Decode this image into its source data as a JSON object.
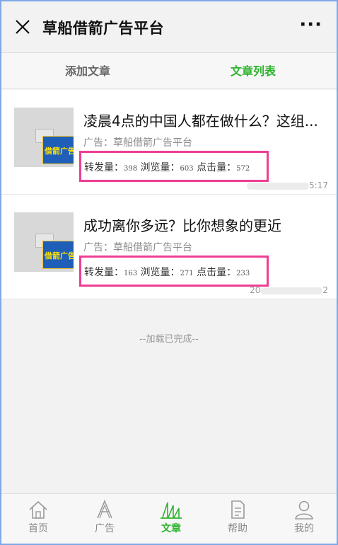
{
  "header": {
    "title": "草船借箭广告平台",
    "more": "···"
  },
  "tabs": [
    {
      "label": "添加文章",
      "active": false
    },
    {
      "label": "文章列表",
      "active": true
    }
  ],
  "articles": [
    {
      "title": "凌晨4点的中国人都在做什么？这组...",
      "source": "广告：草船借箭广告平台",
      "stats": {
        "forward_label": "转发量：",
        "forward": "398",
        "views_label": "浏览量：",
        "views": "603",
        "clicks_label": "点击量：",
        "clicks": "572"
      },
      "thumb_text": "借箭广告",
      "time_tail": "5:17"
    },
    {
      "title": "成功离你多远？比你想象的更近",
      "source": "广告：草船借箭广告平台",
      "stats": {
        "forward_label": "转发量：",
        "forward": "163",
        "views_label": "浏览量：",
        "views": "271",
        "clicks_label": "点击量：",
        "clicks": "233"
      },
      "thumb_text": "借箭广告",
      "time_head": "20",
      "time_tail": "2"
    }
  ],
  "loaded_text": "--加载已完成--",
  "nav": [
    {
      "label": "首页",
      "icon": "home-icon",
      "active": false
    },
    {
      "label": "广告",
      "icon": "ad-icon",
      "active": false
    },
    {
      "label": "文章",
      "icon": "article-icon",
      "active": true
    },
    {
      "label": "帮助",
      "icon": "help-icon",
      "active": false
    },
    {
      "label": "我的",
      "icon": "user-icon",
      "active": false
    }
  ],
  "colors": {
    "accent": "#2db32d",
    "highlight": "#ee3d94",
    "frame": "#7ea9e6"
  }
}
